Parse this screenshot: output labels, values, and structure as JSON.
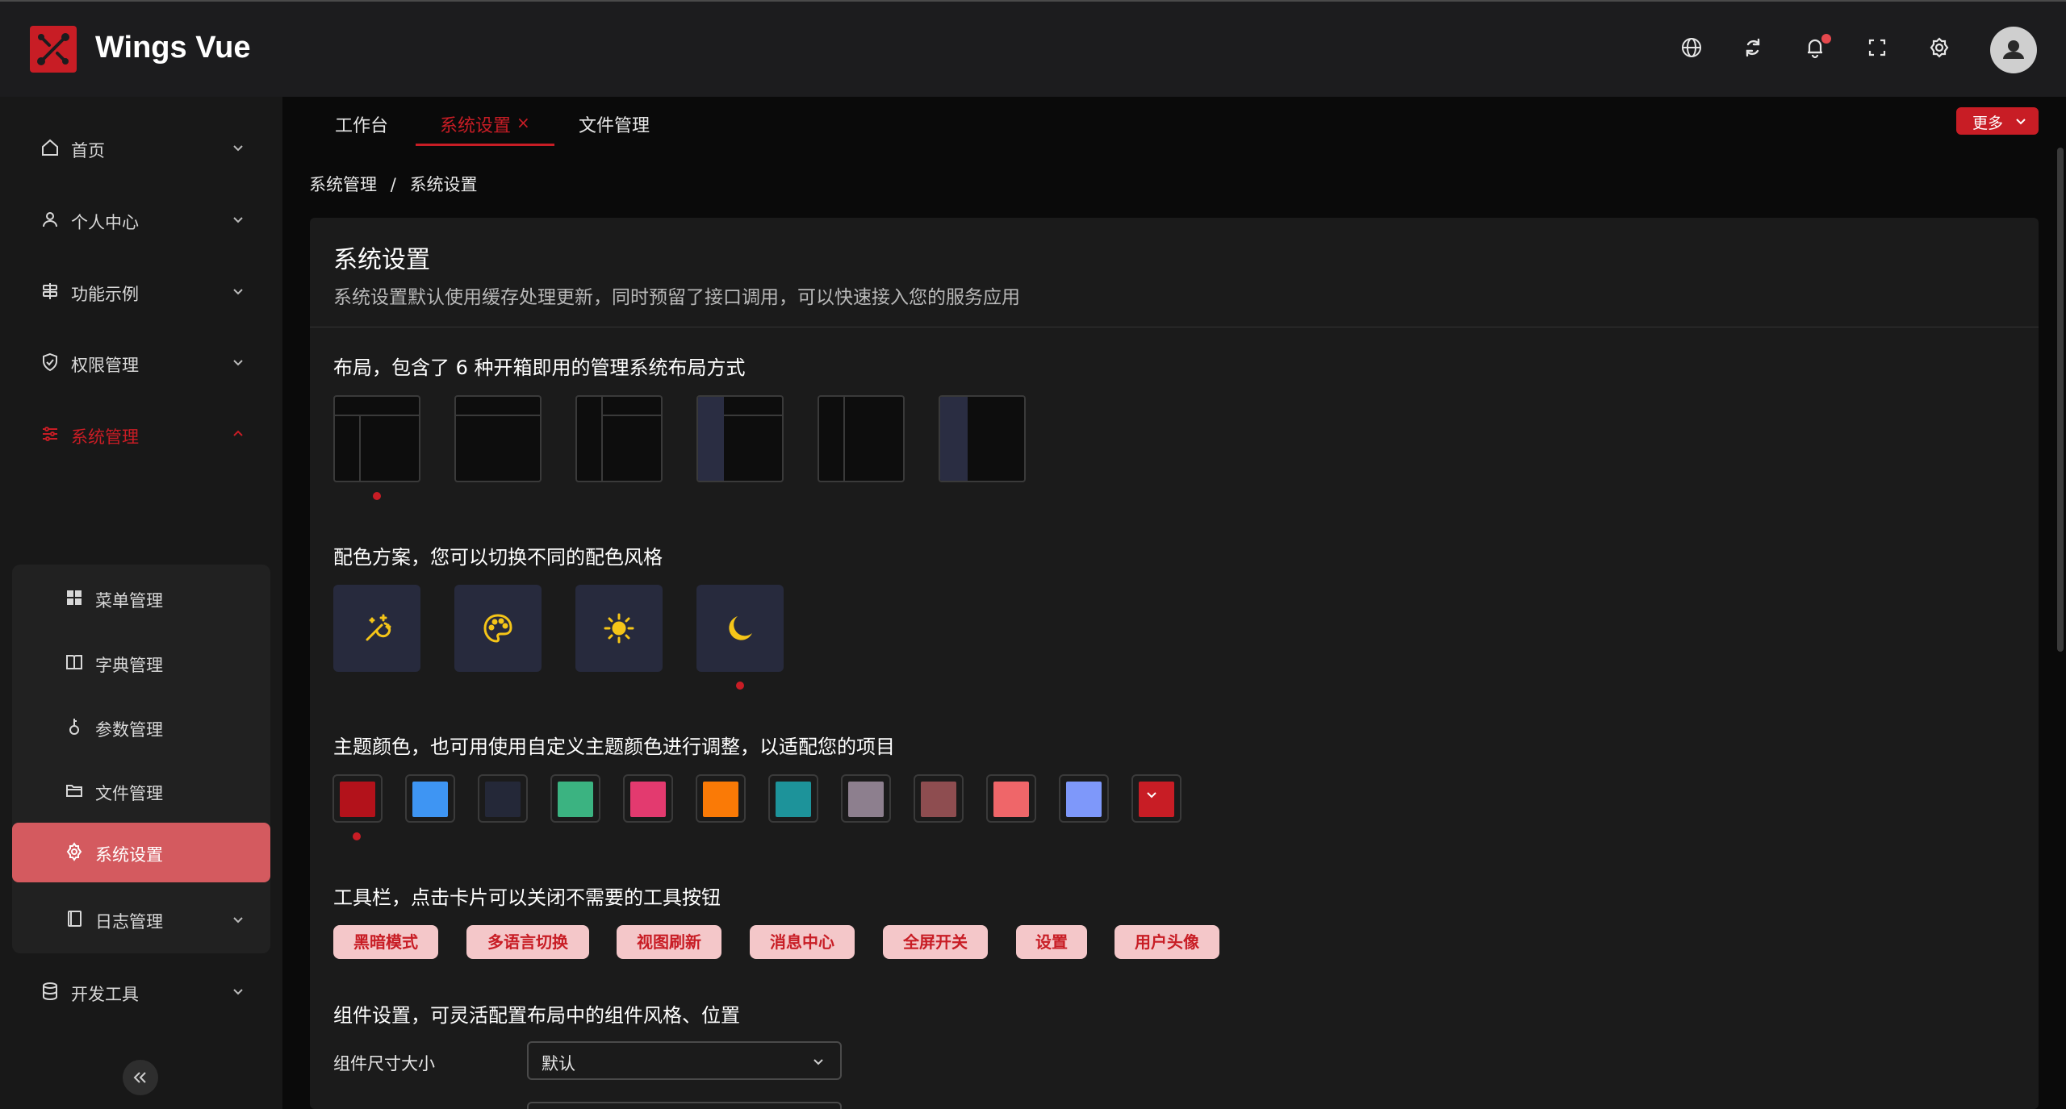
{
  "app": {
    "title": "Wings Vue"
  },
  "header": {
    "icons": [
      "globe-icon",
      "refresh-icon",
      "bell-icon",
      "fullscreen-icon",
      "settings-icon",
      "user-avatar"
    ]
  },
  "sidebar": {
    "items": [
      {
        "label": "首页",
        "icon": "home-icon"
      },
      {
        "label": "个人中心",
        "icon": "user-icon"
      },
      {
        "label": "功能示例",
        "icon": "signpost-icon"
      },
      {
        "label": "权限管理",
        "icon": "shield-icon"
      },
      {
        "label": "系统管理",
        "icon": "sliders-icon"
      },
      {
        "label": "开发工具",
        "icon": "database-icon"
      }
    ],
    "sub_items": [
      {
        "label": "菜单管理",
        "icon": "grid-icon"
      },
      {
        "label": "字典管理",
        "icon": "book-icon"
      },
      {
        "label": "参数管理",
        "icon": "key-icon"
      },
      {
        "label": "文件管理",
        "icon": "folder-icon"
      },
      {
        "label": "系统设置",
        "icon": "gear-icon"
      },
      {
        "label": "日志管理",
        "icon": "log-icon"
      }
    ]
  },
  "tabs": [
    {
      "label": "工作台"
    },
    {
      "label": "系统设置",
      "close": "×"
    },
    {
      "label": "文件管理"
    }
  ],
  "more_label": "更多",
  "breadcrumb": {
    "items": [
      "系统管理",
      "/",
      "系统设置"
    ]
  },
  "card": {
    "title": "系统设置",
    "description": "系统设置默认使用缓存处理更新，同时预留了接口调用，可以快速接入您的服务应用"
  },
  "sections": {
    "layout": "布局，包含了 6 种开箱即用的管理系统布局方式",
    "scheme": "配色方案，您可以切换不同的配色风格",
    "theme_color": "主题颜色，也可用使用自定义主题颜色进行调整，以适配您的项目",
    "toolbar": "工具栏，点击卡片可以关闭不需要的工具按钮",
    "component": "组件设置，可灵活配置布局中的组件风格、位置"
  },
  "theme_colors": [
    "#b3121b",
    "#3e95f3",
    "#242838",
    "#3bb381",
    "#e33a6f",
    "#fa7a06",
    "#1d939a",
    "#8d7f8e",
    "#8e4d50",
    "#ef6669",
    "#7e98fa",
    "#c81d25"
  ],
  "toolbar_tags": [
    "黑暗模式",
    "多语言切换",
    "视图刷新",
    "消息中心",
    "全屏开关",
    "设置",
    "用户头像"
  ],
  "component": {
    "size_label": "组件尺寸大小",
    "size_value": "默认"
  }
}
